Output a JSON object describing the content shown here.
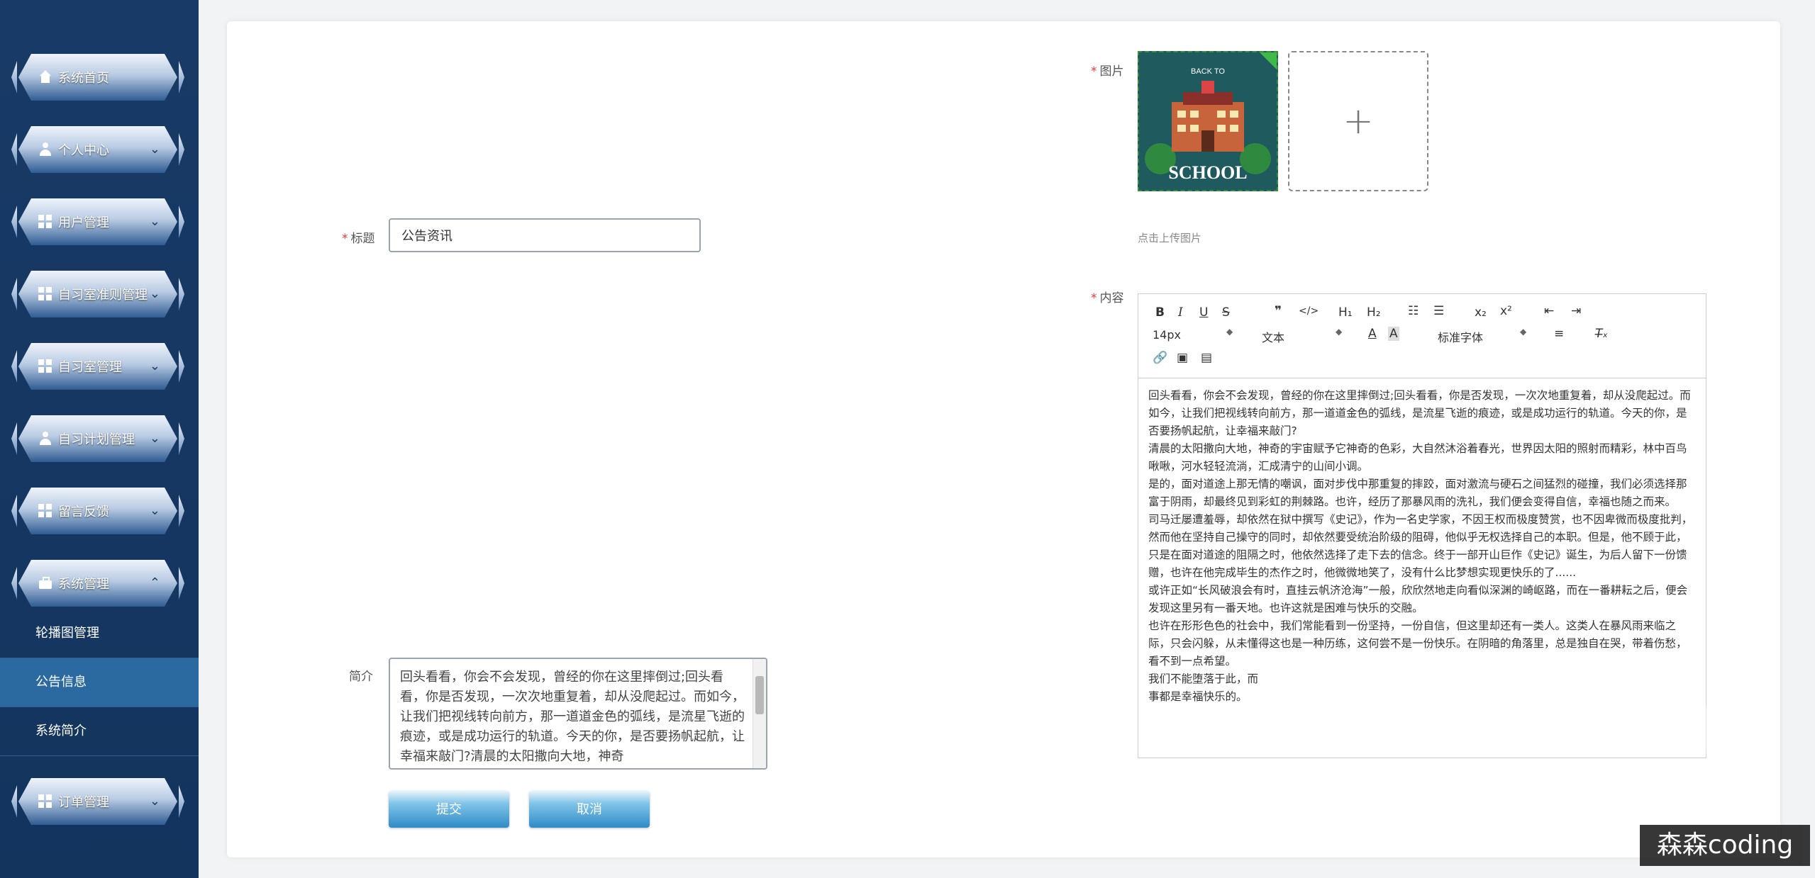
{
  "sidebar": {
    "items": [
      {
        "label": "系统首页",
        "icon": "home-icon",
        "has_chevron": false
      },
      {
        "label": "个人中心",
        "icon": "user-icon",
        "has_chevron": true
      },
      {
        "label": "用户管理",
        "icon": "grid-icon",
        "has_chevron": true
      },
      {
        "label": "自习室准则管理",
        "icon": "grid-icon",
        "has_chevron": true
      },
      {
        "label": "自习室管理",
        "icon": "grid-icon",
        "has_chevron": true
      },
      {
        "label": "自习计划管理",
        "icon": "user-icon",
        "has_chevron": true
      },
      {
        "label": "留言反馈",
        "icon": "grid-icon",
        "has_chevron": true
      },
      {
        "label": "系统管理",
        "icon": "briefcase-icon",
        "has_chevron": true,
        "expanded": true
      },
      {
        "label": "订单管理",
        "icon": "grid-icon",
        "has_chevron": true
      }
    ],
    "system_submenu": [
      "轮播图管理",
      "公告信息",
      "系统简介"
    ],
    "active_submenu": "公告信息"
  },
  "form": {
    "title_label": "标题",
    "title_value": "公告资讯",
    "image_label": "图片",
    "image_hint": "点击上传图片",
    "image_thumb_text": "SCHOOL",
    "image_thumb_top_text": "BACK TO",
    "content_label": "内容",
    "summary_label": "简介",
    "summary_value": "回头看看，你会不会发现，曾经的你在这里摔倒过;回头看看，你是否发现，一次次地重复着，却从没爬起过。而如今，让我们把视线转向前方，那一道道金色的弧线，是流星飞逝的痕迹，或是成功运行的轨道。今天的你，是否要扬帆起航，让幸福来敲门?清晨的太阳撒向大地，神奇",
    "submit_label": "提交",
    "cancel_label": "取消"
  },
  "editor": {
    "toolbar_row1": [
      "B",
      "I",
      "U",
      "S",
      "99",
      "</>",
      "H1",
      "H2",
      "ol",
      "ul",
      "x2",
      "x2",
      "outdent",
      "indent"
    ],
    "font_size": "14px",
    "text_type": "文本",
    "font_family": "标准字体",
    "content": [
      "回头看看，你会不会发现，曾经的你在这里摔倒过;回头看看，你是否发现，一次次地重复着，却从没爬起过。而如今，让我们把视线转向前方，那一道道金色的弧线，是流星飞逝的痕迹，或是成功运行的轨道。今天的你，是否要扬帆起航，让幸福来敲门?",
      "清晨的太阳撒向大地，神奇的宇宙赋予它神奇的色彩，大自然沐浴着春光，世界因太阳的照射而精彩，林中百鸟啾啾，河水轻轻流淌，汇成清宁的山间小调。",
      "是的，面对道途上那无情的嘲讽，面对步伐中那重复的摔跤，面对激流与硬石之间猛烈的碰撞，我们必须选择那富于阴雨，却最终见到彩虹的荆棘路。也许，经历了那暴风雨的洗礼，我们便会变得自信，幸福也随之而来。",
      "司马迁屡遭羞辱，却依然在狱中撰写《史记》，作为一名史学家，不因王权而极度赞赏，也不因卑微而极度批判，然而他在坚持自己操守的同时，却依然要受统治阶级的阻碍，他似乎无权选择自己的本职。但是，他不顾于此，只是在面对道途的阻隔之时，他依然选择了走下去的信念。终于一部开山巨作《史记》诞生，为后人留下一份馈赠，也许在他完成毕生的杰作之时，他微微地笑了，没有什么比梦想实现更快乐的了......",
      "或许正如“长风破浪会有时，直挂云帆济沧海”一般，欣欣然地走向看似深渊的崎岖路，而在一番耕耘之后，便会发现这里另有一番天地。也许这就是困难与快乐的交融。",
      "也许在形形色色的社会中，我们常能看到一份坚持，一份自信，但这里却还有一类人。这类人在暴风雨来临之际，只会闪躲，从未懂得这也是一种历练，这何尝不是一份快乐。在阴暗的角落里，总是独自在哭，带着伤愁，看不到一点希望。",
      "我们不能堕落于此，而",
      "事都是幸福快乐的。"
    ]
  },
  "watermark": "森森coding"
}
